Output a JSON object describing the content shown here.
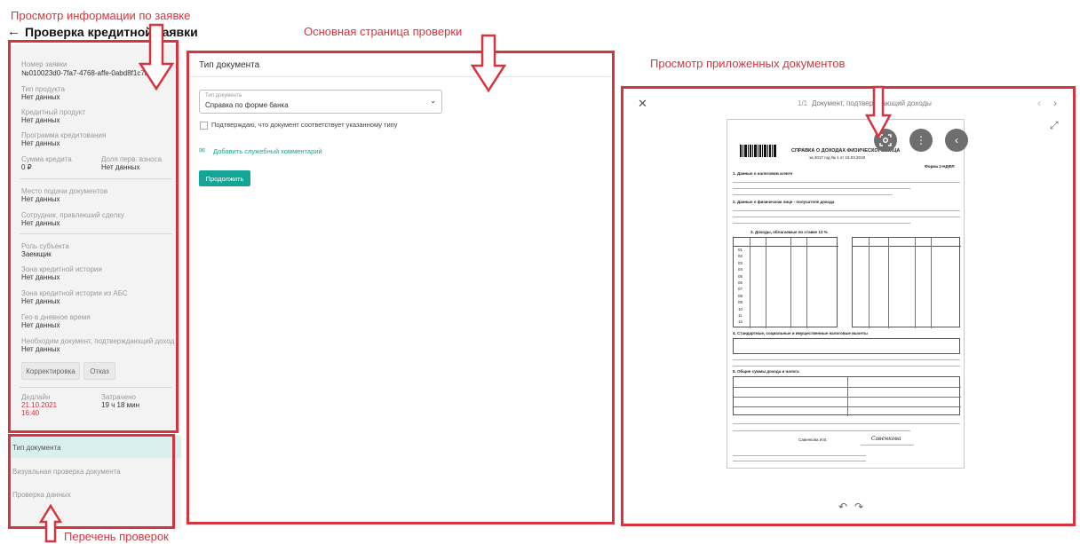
{
  "annotations": {
    "info_view": "Просмотр информации по заявке",
    "main_page": "Основная страница проверки",
    "docs_view": "Просмотр приложенных документов",
    "checks_list": "Перечень проверок"
  },
  "header": {
    "back_icon": "arrow-left-icon",
    "title": "Проверка кредитной заявки"
  },
  "info": {
    "app_number_label": "Номер заявки",
    "app_number_value": "№010023d0-7fa7-4768-affe-0abd8f1c7b9",
    "product_type_label": "Тип продукта",
    "product_type_value": "Нет данных",
    "credit_product_label": "Кредитный продукт",
    "credit_product_value": "Нет данных",
    "program_label": "Программа кредитования",
    "program_value": "Нет данных",
    "amount_label": "Сумма кредита",
    "amount_value": "0 ₽",
    "down_payment_label": "Доля перв. взноса",
    "down_payment_value": "Нет данных",
    "submit_place_label": "Место подачи документов",
    "submit_place_value": "Нет данных",
    "employee_label": "Сотрудник, привлекший сделку",
    "employee_value": "Нет данных",
    "role_label": "Роль субъекта",
    "role_value": "Заемщик",
    "credit_zone_label": "Зона кредитной истории",
    "credit_zone_value": "Нет данных",
    "credit_zone_abc_label": "Зона кредитной истории из АБС",
    "credit_zone_abc_value": "Нет данных",
    "geo_label": "Гео в дневное время",
    "geo_value": "Нет данных",
    "income_doc_label": "Необходим документ, подтверждающий доход",
    "income_doc_value": "Нет данных",
    "correction_button": "Корректировка",
    "reject_button": "Отказ",
    "deadline_label": "Дедлайн",
    "deadline_date": "21.10.2021",
    "deadline_time": "16:40",
    "spent_label": "Затрачено",
    "spent_value": "19 ч 18 мин"
  },
  "checks": {
    "items": [
      "Тип документа",
      "Визуальная проверка документа",
      "Проверка данных"
    ],
    "active_index": 0
  },
  "main": {
    "title": "Тип документа",
    "select_label": "Тип документа",
    "select_value": "Справка по форме банка",
    "confirm_text": "Подтверждаю, что документ соответствует указанному типу",
    "comment_link": "Добавить служебный комментарий",
    "continue_button": "Продолжить"
  },
  "viewer": {
    "counter": "1/1",
    "doc_title": "Документ, подтверждающий доходы",
    "close_icon": "close-icon",
    "icons": [
      "scan-icon",
      "more-vertical-icon",
      "chevron-left-icon",
      "expand-icon",
      "rotate-left-icon",
      "rotate-right-icon"
    ],
    "doc": {
      "heading": "СПРАВКА О ДОХОДАХ ФИЗИЧЕСКОГО ЛИЦА",
      "year_line": "за 2017 год № 1 от 15.03.2018",
      "form": "Форма 2-НДФЛ",
      "s1": "1. Данные о налоговом агенте",
      "s2": "2. Данные о физическом лице - получателе дохода",
      "s3": "3. Доходы, облагаемые по ставке 13 %",
      "s4": "4. Стандартные, социальные и имущественные налоговые вычеты",
      "s5": "5. Общие суммы дохода и налога",
      "months": [
        "01",
        "02",
        "03",
        "04",
        "05",
        "06",
        "07",
        "08",
        "09",
        "10",
        "11",
        "12"
      ],
      "signer": "Савенкова И.В."
    }
  },
  "colors": {
    "annotation_red": "#d8343f",
    "accent_teal": "#14a597",
    "active_check_bg": "#d9f1ee",
    "deadline_red": "#d8343f"
  }
}
